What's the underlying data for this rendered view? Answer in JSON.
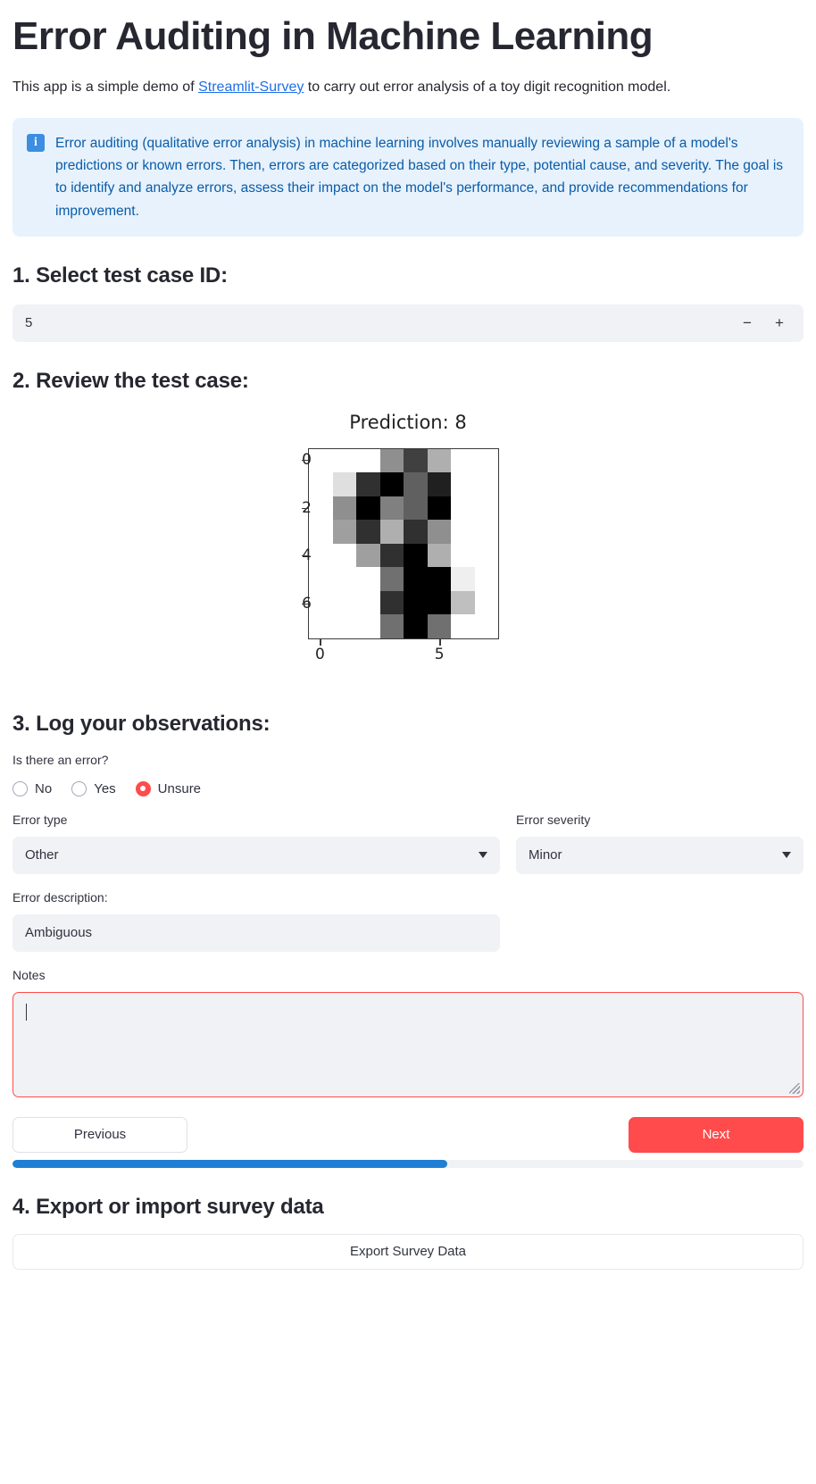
{
  "header": {
    "title": "Error Auditing in Machine Learning",
    "intro_before": "This app is a simple demo of ",
    "intro_link": "Streamlit-Survey",
    "intro_after": " to carry out error analysis of a toy digit recognition model."
  },
  "info": {
    "icon": "info-icon",
    "glyph": "i",
    "text": "Error auditing (qualitative error analysis) in machine learning involves manually reviewing a sample of a model's predictions or known errors. Then, errors are categorized based on their type, potential cause, and severity. The goal is to identify and analyze errors, assess their impact on the model's performance, and provide recommendations for improvement.",
    "bg_color": "#e7f2fd",
    "text_color": "#0b5ca8"
  },
  "step1": {
    "heading": "1. Select test case ID:",
    "value": "5",
    "decrement_label": "−",
    "increment_label": "+"
  },
  "step2": {
    "heading": "2. Review the test case:"
  },
  "chart_data": {
    "type": "heatmap",
    "title": "Prediction: 8",
    "xlabel": "",
    "ylabel": "",
    "xticks": [
      0,
      5
    ],
    "yticks": [
      0,
      2,
      4,
      6
    ],
    "xlim": [
      -0.5,
      7.5
    ],
    "ylim": [
      7.5,
      -0.5
    ],
    "colormap": "gray_r",
    "vmin": 0,
    "vmax": 16,
    "grid": false,
    "legend": "none",
    "rows": 8,
    "cols": 8,
    "values": [
      [
        0,
        0,
        0,
        7,
        12,
        5,
        0,
        0
      ],
      [
        0,
        2,
        13,
        16,
        10,
        14,
        0,
        0
      ],
      [
        0,
        7,
        16,
        8,
        10,
        16,
        0,
        0
      ],
      [
        0,
        6,
        13,
        5,
        13,
        7,
        0,
        0
      ],
      [
        0,
        0,
        6,
        13,
        16,
        5,
        0,
        0
      ],
      [
        0,
        0,
        0,
        9,
        16,
        16,
        1,
        0
      ],
      [
        0,
        0,
        0,
        13,
        16,
        16,
        4,
        0
      ],
      [
        0,
        0,
        0,
        9,
        16,
        9,
        0,
        0
      ]
    ]
  },
  "step3": {
    "heading": "3. Log your observations:",
    "error_question_label": "Is there an error?",
    "error_options": [
      "No",
      "Yes",
      "Unsure"
    ],
    "error_selected": "Unsure",
    "error_type_label": "Error type",
    "error_type_value": "Other",
    "error_severity_label": "Error severity",
    "error_severity_value": "Minor",
    "error_description_label": "Error description:",
    "error_description_value": "Ambiguous",
    "notes_label": "Notes",
    "notes_value": "",
    "notes_placeholder": ""
  },
  "nav": {
    "previous_label": "Previous",
    "next_label": "Next",
    "progress_percent": 55,
    "next_color": "#ff4b4b",
    "progress_color": "#1f7fd4"
  },
  "step4": {
    "heading": "4. Export or import survey data",
    "export_label": "Export Survey Data"
  }
}
